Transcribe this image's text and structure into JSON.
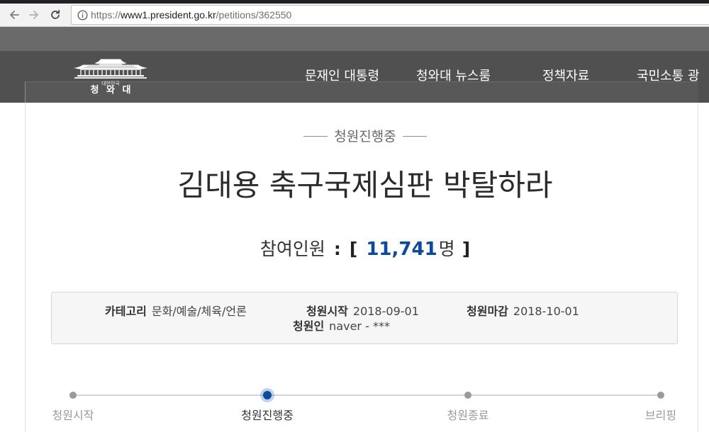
{
  "browser": {
    "url_scheme": "https://",
    "url_host": "www1.president.go.kr",
    "url_path": "/petitions/362550",
    "icons": [
      "arrow-left-icon",
      "arrow-right-icon",
      "reload-icon",
      "info-icon"
    ]
  },
  "site": {
    "logo": {
      "subtitle": "대한민국",
      "name": "청 와 대",
      "icon": "blue-house-building-icon"
    },
    "nav": [
      {
        "label": "문재인 대통령"
      },
      {
        "label": "청와대 뉴스룸"
      },
      {
        "label": "정책자료"
      },
      {
        "label": "국민소통 광"
      }
    ]
  },
  "petition": {
    "status": "청원진행중",
    "title": "김대용 축구국제심판 박탈하라",
    "participants": {
      "label": "참여인원",
      "colon": ":",
      "bracket_open": "[",
      "count": "11,741",
      "unit": "명",
      "bracket_close": "]"
    },
    "info": {
      "category": {
        "label": "카테고리",
        "value": "문화/예술/체육/언론"
      },
      "start_date": {
        "label": "청원시작",
        "value": "2018-09-01"
      },
      "end_date": {
        "label": "청원마감",
        "value": "2018-10-01"
      },
      "petitioner": {
        "label": "청원인",
        "value": "naver - ***"
      }
    },
    "progress": {
      "steps": [
        {
          "label": "청원시작"
        },
        {
          "label": "청원진행중"
        },
        {
          "label": "청원종료"
        },
        {
          "label": "브리핑"
        }
      ],
      "active_index": 1
    }
  },
  "colors": {
    "accent": "#0b4aa2",
    "header_bar": "#505050",
    "header_top": "#6a6a6a",
    "muted_text": "#999999"
  }
}
